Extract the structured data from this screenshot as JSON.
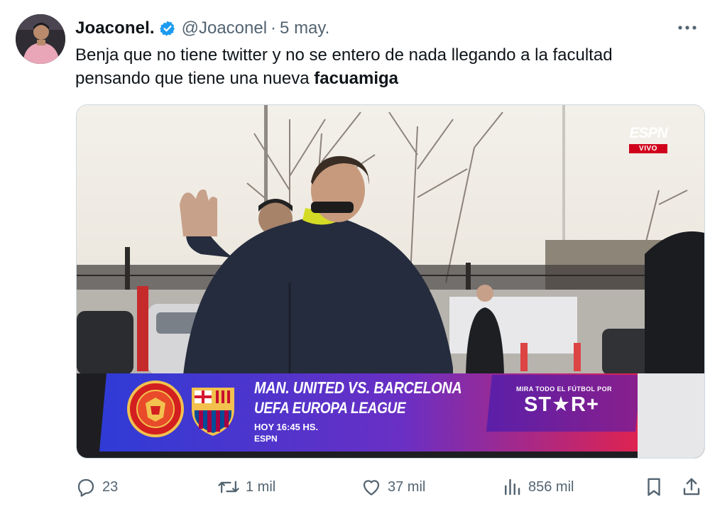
{
  "tweet": {
    "author_name": "Joaconel.",
    "handle": "@Joaconel",
    "separator": "·",
    "date": "5 may.",
    "text_plain": "Benja que no tiene twitter y no se entero de nada llegando a la facultad pensando que tiene una nueva ",
    "text_bold": "facuamiga"
  },
  "media": {
    "broadcaster_logo": "ESPN",
    "live_label": "VIVO",
    "match_title": "MAN. UNITED VS. BARCELONA",
    "competition": "UEFA EUROPA LEAGUE",
    "kickoff": "HOY  16:45 HS.",
    "channel": "ESPN",
    "promo_text": "MIRA TODO EL FÚTBOL POR",
    "promo_brand": "ST★R+",
    "colors": {
      "banner_left": "#2f3bd6",
      "banner_right": "#e5224a",
      "star_red": "#e5224a"
    }
  },
  "actions": {
    "replies": "23",
    "reposts": "1 mil",
    "likes": "37 mil",
    "views": "856 mil"
  },
  "icons": [
    "verified-badge-icon",
    "more-icon",
    "reply-icon",
    "repost-icon",
    "like-icon",
    "views-icon",
    "bookmark-icon",
    "share-icon"
  ]
}
